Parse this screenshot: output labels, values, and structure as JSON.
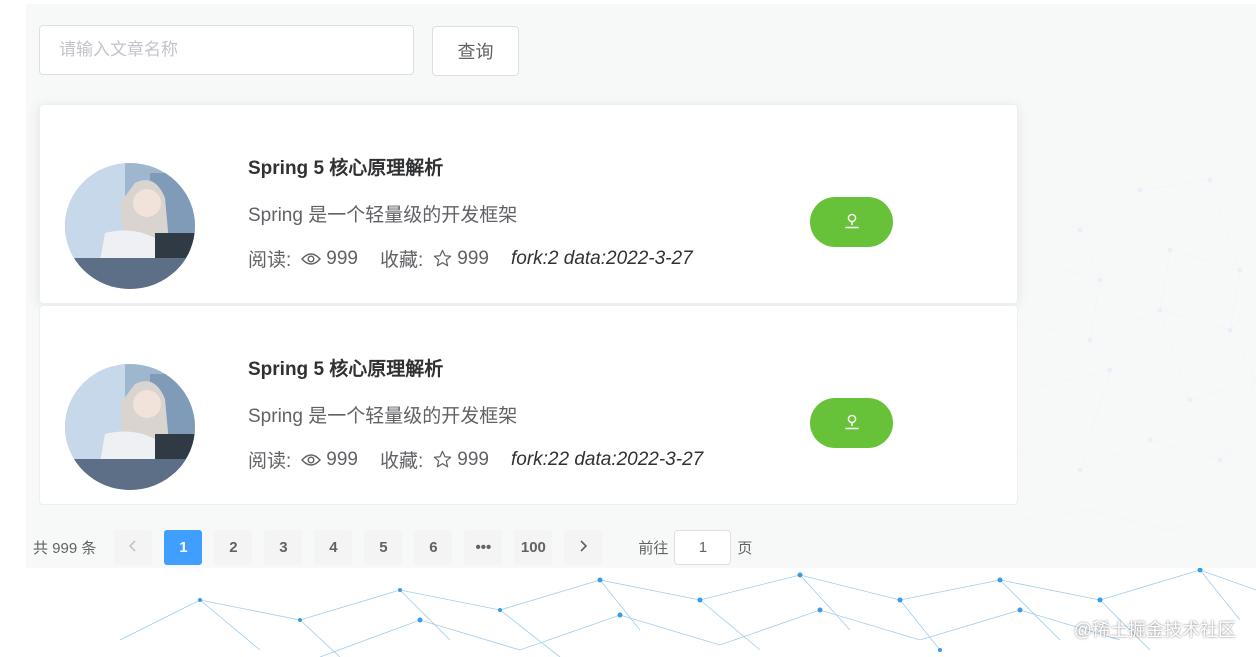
{
  "search": {
    "placeholder": "请输入文章名称",
    "value": "",
    "button_label": "查询"
  },
  "articles": [
    {
      "title": "Spring 5 核心原理解析",
      "description": "Spring 是一个轻量级的开发框架",
      "read_label": "阅读:",
      "read_count": "999",
      "fav_label": "收藏:",
      "fav_count": "999",
      "extra": "fork:2 data:2022-3-27"
    },
    {
      "title": "Spring 5 核心原理解析",
      "description": "Spring 是一个轻量级的开发框架",
      "read_label": "阅读:",
      "read_count": "999",
      "fav_label": "收藏:",
      "fav_count": "999",
      "extra": "fork:22 data:2022-3-27"
    }
  ],
  "pagination": {
    "total": "共 999 条",
    "prev_icon": "chevron-left-icon",
    "pages": [
      "1",
      "2",
      "3",
      "4",
      "5",
      "6",
      "•••",
      "100"
    ],
    "active_page": "1",
    "next_icon": "chevron-right-icon",
    "goto_prefix": "前往",
    "goto_value": "1",
    "goto_suffix": "页"
  },
  "watermark": "@稀土掘金技术社区",
  "colors": {
    "primary": "#409eff",
    "success": "#67c23a"
  },
  "icons": {
    "eye": "eye-icon",
    "star": "star-icon",
    "action": "user-icon"
  }
}
